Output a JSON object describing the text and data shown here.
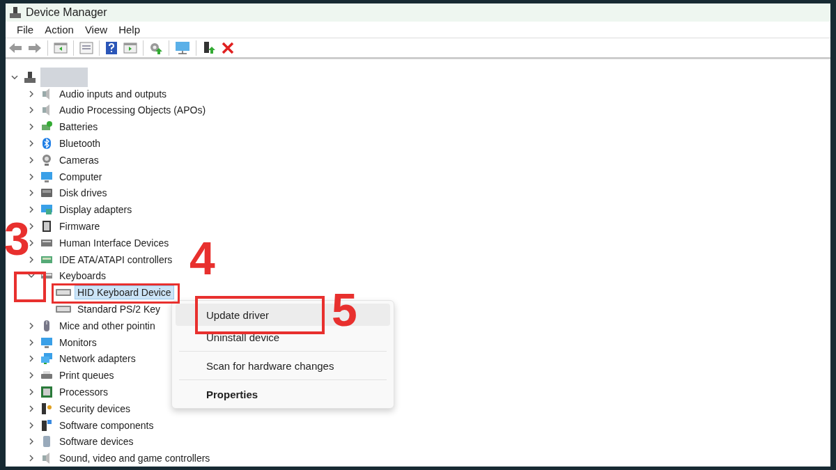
{
  "window": {
    "title": "Device Manager"
  },
  "menu": [
    "File",
    "Action",
    "View",
    "Help"
  ],
  "tree": {
    "expanded": true,
    "children": [
      {
        "label": "Audio inputs and outputs",
        "expanded": false
      },
      {
        "label": "Audio Processing Objects (APOs)",
        "expanded": false
      },
      {
        "label": "Batteries",
        "expanded": false
      },
      {
        "label": "Bluetooth",
        "expanded": false
      },
      {
        "label": "Cameras",
        "expanded": false
      },
      {
        "label": "Computer",
        "expanded": false
      },
      {
        "label": "Disk drives",
        "expanded": false
      },
      {
        "label": "Display adapters",
        "expanded": false
      },
      {
        "label": "Firmware",
        "expanded": false
      },
      {
        "label": "Human Interface Devices",
        "expanded": false
      },
      {
        "label": "IDE ATA/ATAPI controllers",
        "expanded": false
      },
      {
        "label": "Keyboards",
        "expanded": true,
        "children": [
          {
            "label": "HID Keyboard Device",
            "selected": true
          },
          {
            "label": "Standard PS/2 Key",
            "selected": false
          }
        ]
      },
      {
        "label": "Mice and other pointin",
        "expanded": false
      },
      {
        "label": "Monitors",
        "expanded": false
      },
      {
        "label": "Network adapters",
        "expanded": false
      },
      {
        "label": "Print queues",
        "expanded": false
      },
      {
        "label": "Processors",
        "expanded": false
      },
      {
        "label": "Security devices",
        "expanded": false
      },
      {
        "label": "Software components",
        "expanded": false
      },
      {
        "label": "Software devices",
        "expanded": false
      },
      {
        "label": "Sound, video and game controllers",
        "expanded": false
      }
    ]
  },
  "context_menu": [
    {
      "label": "Update driver",
      "highlighted": true,
      "default": false
    },
    {
      "label": "Uninstall device",
      "highlighted": false,
      "default": false
    },
    {
      "label": "Scan for hardware changes",
      "highlighted": false,
      "default": false
    },
    {
      "label": "Properties",
      "highlighted": false,
      "default": true
    }
  ],
  "annotations": [
    "3",
    "4",
    "5"
  ]
}
